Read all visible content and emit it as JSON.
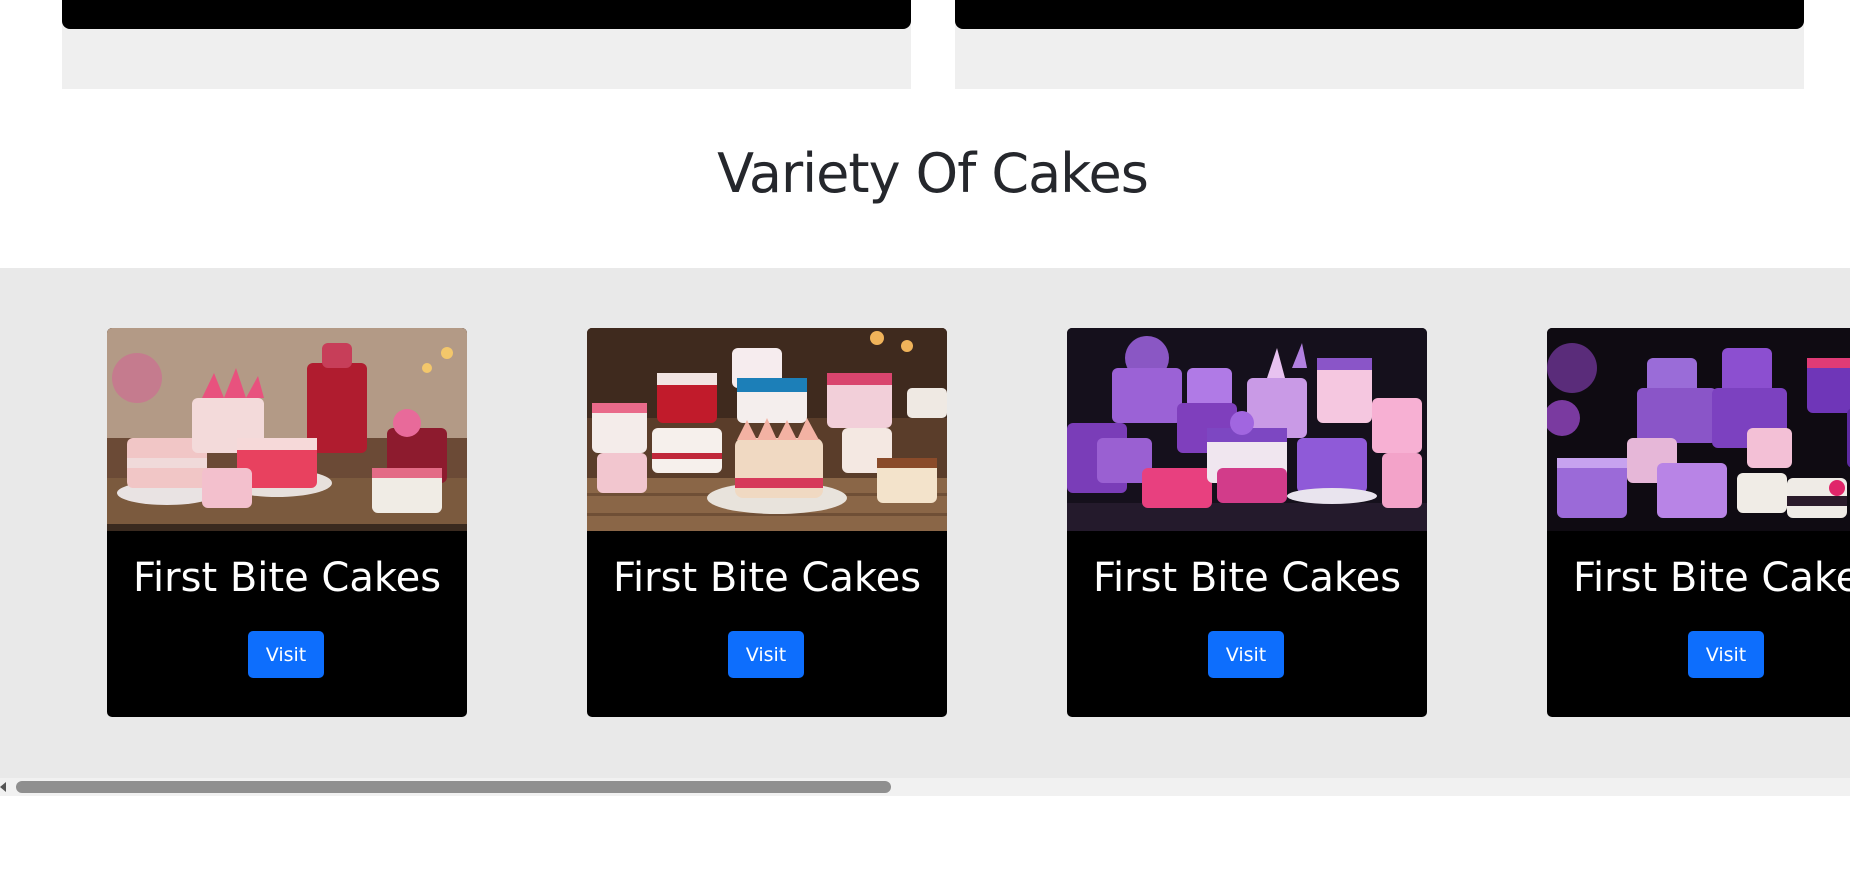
{
  "section": {
    "title": "Variety Of Cakes"
  },
  "cards": [
    {
      "name": "First Bite Cakes",
      "button": "Visit",
      "image": "cake-table-pink-red"
    },
    {
      "name": "First Bite Cakes",
      "button": "Visit",
      "image": "cake-table-colorful"
    },
    {
      "name": "First Bite Cakes",
      "button": "Visit",
      "image": "cake-table-purple"
    },
    {
      "name": "First Bite Cakes",
      "button": "Visit",
      "image": "cake-table-purple-pink"
    }
  ],
  "colors": {
    "button": "#0d6efd",
    "card_bg": "#000000",
    "band_bg": "#e9e9e9",
    "title": "#25272c"
  }
}
